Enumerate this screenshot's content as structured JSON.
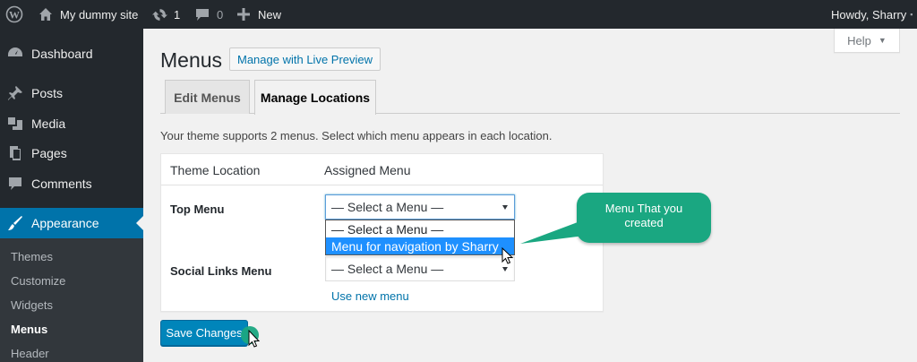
{
  "adminbar": {
    "site_name": "My dummy site",
    "updates_count": "1",
    "comments_count": "0",
    "new_label": "New",
    "howdy": "Howdy, Sharry"
  },
  "sidebar": {
    "items": [
      {
        "label": "Dashboard",
        "icon": "dashboard-icon"
      },
      {
        "label": "Posts",
        "icon": "pin-icon"
      },
      {
        "label": "Media",
        "icon": "media-icon"
      },
      {
        "label": "Pages",
        "icon": "pages-icon"
      },
      {
        "label": "Comments",
        "icon": "comment-icon"
      },
      {
        "label": "Appearance",
        "icon": "brush-icon",
        "active": true
      }
    ],
    "submenu": [
      "Themes",
      "Customize",
      "Widgets",
      "Menus",
      "Header"
    ],
    "current_sub": "Menus"
  },
  "help": {
    "label": "Help"
  },
  "header": {
    "title": "Menus",
    "live_preview_label": "Manage with Live Preview"
  },
  "tabs": [
    {
      "label": "Edit Menus",
      "active": false
    },
    {
      "label": "Manage Locations",
      "active": true
    }
  ],
  "intro_text": "Your theme supports 2 menus. Select which menu appears in each location.",
  "locations": {
    "col_location": "Theme Location",
    "col_assigned": "Assigned Menu",
    "rows": [
      {
        "label": "Top Menu",
        "selected": "— Select a Menu —"
      },
      {
        "label": "Social Links Menu",
        "selected": "— Select a Menu —"
      }
    ],
    "dropdown_options": [
      "— Select a Menu —",
      "Menu for navigation by Sharry"
    ],
    "use_new_menu": "Use new menu"
  },
  "save_label": "Save Changes",
  "callout": {
    "line1": "Menu That you",
    "line2": "created"
  },
  "colors": {
    "adminbar": "#23282d",
    "sidebar_active": "#0073aa",
    "primary_button": "#0085ba",
    "callout": "#1aa781",
    "dropdown_highlight": "#1e90ff"
  }
}
